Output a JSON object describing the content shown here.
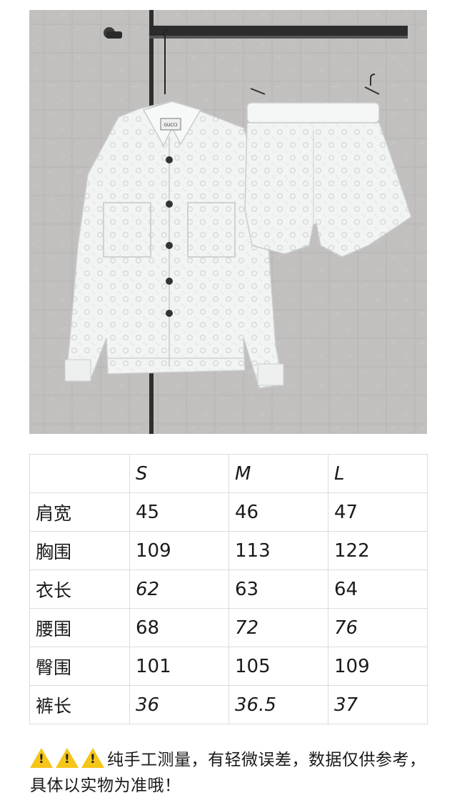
{
  "photo": {
    "label_text": "GUCCI"
  },
  "size_table": {
    "header": [
      "",
      "S",
      "M",
      "L"
    ],
    "rows": [
      {
        "label": "肩宽",
        "values": [
          "45",
          "46",
          "47"
        ]
      },
      {
        "label": "胸围",
        "values": [
          "109",
          "113",
          "122"
        ]
      },
      {
        "label": "衣长",
        "values": [
          "62",
          "63",
          "64"
        ]
      },
      {
        "label": "腰围",
        "values": [
          "68",
          "72",
          "76"
        ]
      },
      {
        "label": "臀围",
        "values": [
          "101",
          "105",
          "109"
        ]
      },
      {
        "label": "裤长",
        "values": [
          "36",
          "36.5",
          "37"
        ]
      }
    ]
  },
  "note": {
    "icon": "warning-icon",
    "text": "纯手工测量，有轻微误差，数据仅供参考，具体以实物为准哦！"
  }
}
